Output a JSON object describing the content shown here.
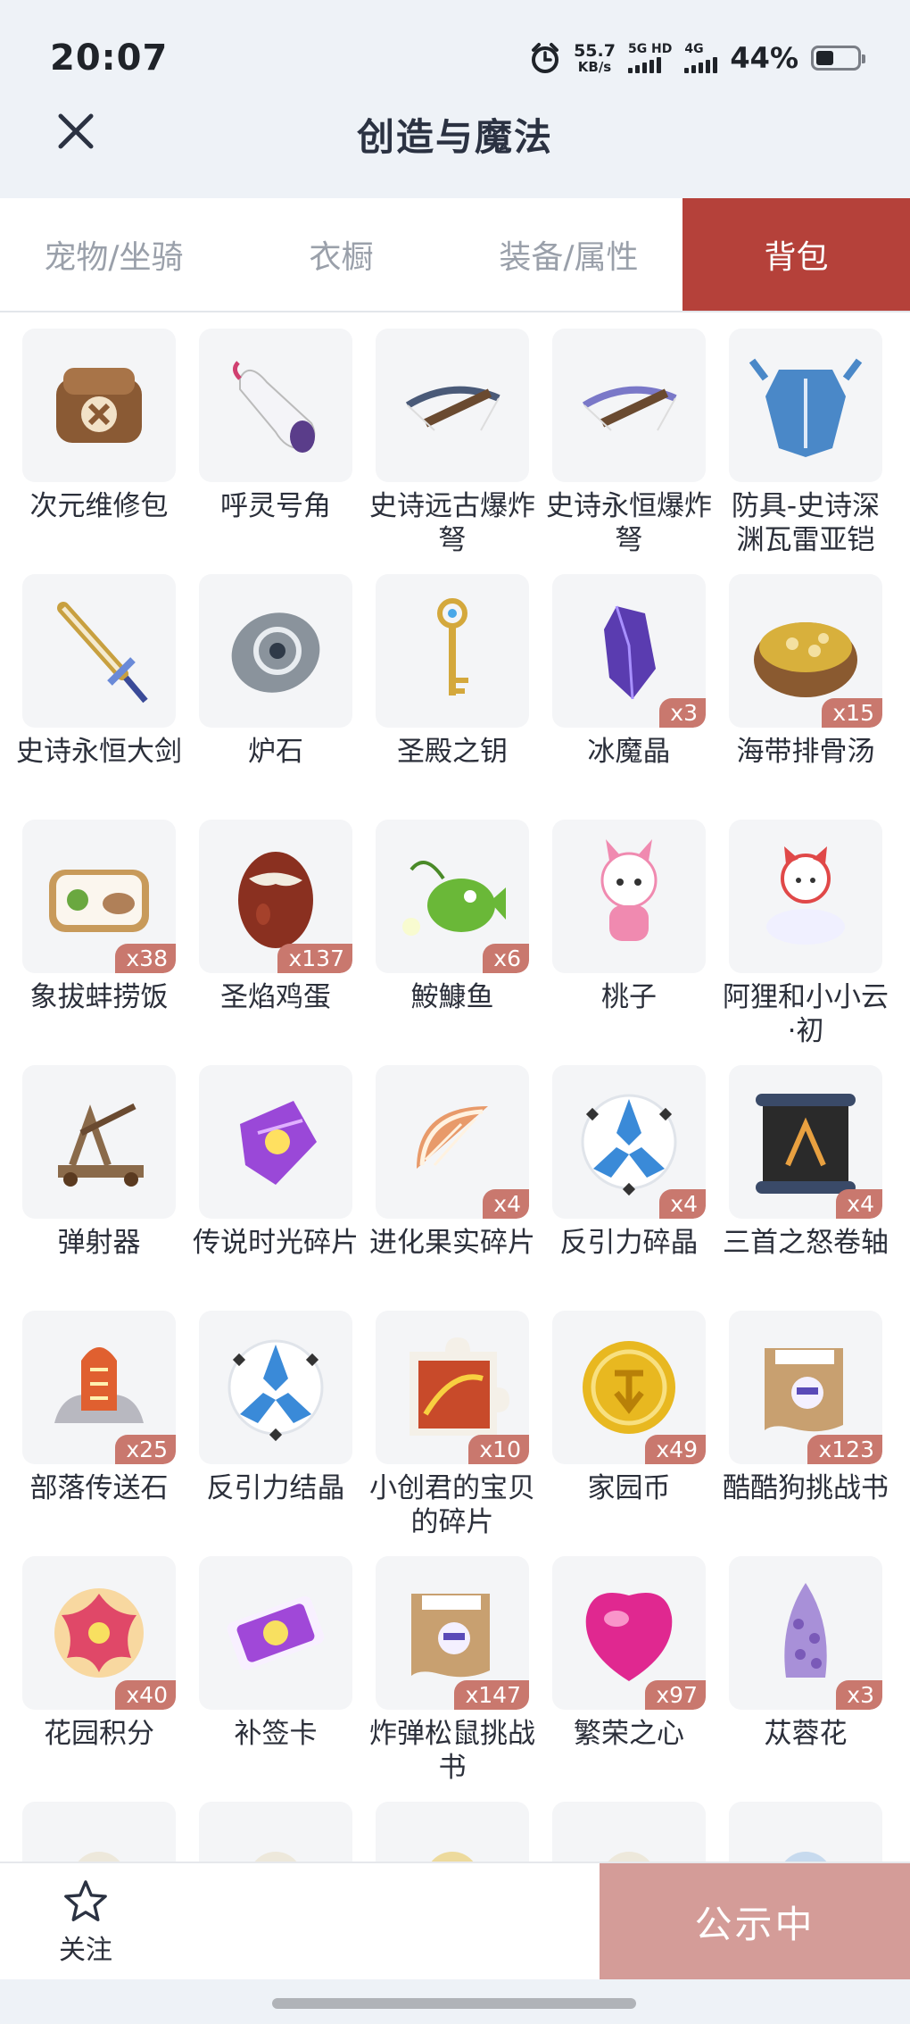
{
  "status_bar": {
    "time": "20:07",
    "net_speed": "55.7",
    "net_unit": "KB/s",
    "signal1_label": "5G HD",
    "signal2_label": "4G",
    "battery": "44%",
    "battery_level": 0.44
  },
  "header": {
    "title": "创造与魔法"
  },
  "tabs": [
    {
      "label": "宠物/坐骑",
      "active": false
    },
    {
      "label": "衣橱",
      "active": false
    },
    {
      "label": "装备/属性",
      "active": false
    },
    {
      "label": "背包",
      "active": true
    }
  ],
  "items": [
    {
      "name": "次元维修包",
      "count": "",
      "icon": "repair-bag-icon",
      "color": "#8a5a34"
    },
    {
      "name": "呼灵号角",
      "count": "",
      "icon": "horn-icon",
      "color": "#5a3d8a"
    },
    {
      "name": "史诗远古爆炸弩",
      "count": "",
      "icon": "crossbow-icon",
      "color": "#4a5a78"
    },
    {
      "name": "史诗永恒爆炸弩",
      "count": "",
      "icon": "crossbow-icon",
      "color": "#7a78c8"
    },
    {
      "name": "防具-史诗深渊瓦雷亚铠",
      "count": "",
      "icon": "armor-icon",
      "color": "#4a88c8"
    },
    {
      "name": "史诗永恒大剑",
      "count": "",
      "icon": "sword-icon",
      "color": "#c8a040"
    },
    {
      "name": "炉石",
      "count": "",
      "icon": "hearthstone-icon",
      "color": "#8a939c"
    },
    {
      "name": "圣殿之钥",
      "count": "",
      "icon": "key-icon",
      "color": "#d4a83c"
    },
    {
      "name": "冰魔晶",
      "count": "x3",
      "icon": "crystal-icon",
      "color": "#5a3cb0"
    },
    {
      "name": "海带排骨汤",
      "count": "x15",
      "icon": "soup-icon",
      "color": "#d8b03c"
    },
    {
      "name": "象拔蚌捞饭",
      "count": "x38",
      "icon": "bento-icon",
      "color": "#c89a5a"
    },
    {
      "name": "圣焰鸡蛋",
      "count": "x137",
      "icon": "egg-icon",
      "color": "#8a3020"
    },
    {
      "name": "鮟鱇鱼",
      "count": "x6",
      "icon": "fish-icon",
      "color": "#6ab838"
    },
    {
      "name": "桃子",
      "count": "",
      "icon": "pet-icon",
      "color": "#f08ab0"
    },
    {
      "name": "阿狸和小小云·初",
      "count": "",
      "icon": "pet-cloud-icon",
      "color": "#e04848"
    },
    {
      "name": "弹射器",
      "count": "",
      "icon": "catapult-icon",
      "color": "#8a6a4a"
    },
    {
      "name": "传说时光碎片",
      "count": "",
      "icon": "time-shard-icon",
      "color": "#9a48d8"
    },
    {
      "name": "进化果实碎片",
      "count": "x4",
      "icon": "fruit-shard-icon",
      "color": "#e89a6a"
    },
    {
      "name": "反引力碎晶",
      "count": "x4",
      "icon": "antigravity-icon",
      "color": "#3a8ad8"
    },
    {
      "name": "三首之怒卷轴",
      "count": "x4",
      "icon": "scroll-icon",
      "color": "#2a2a2a"
    },
    {
      "name": "部落传送石",
      "count": "x25",
      "icon": "teleport-stone-icon",
      "color": "#e06030"
    },
    {
      "name": "反引力结晶",
      "count": "",
      "icon": "antigravity-icon",
      "color": "#3a8ad8"
    },
    {
      "name": "小创君的宝贝的碎片",
      "count": "x10",
      "icon": "puzzle-icon",
      "color": "#c84a2a"
    },
    {
      "name": "家园币",
      "count": "x49",
      "icon": "coin-icon",
      "color": "#e8b820"
    },
    {
      "name": "酷酷狗挑战书",
      "count": "x123",
      "icon": "wanted-icon",
      "color": "#c8a070"
    },
    {
      "name": "花园积分",
      "count": "x40",
      "icon": "flower-badge-icon",
      "color": "#e04868"
    },
    {
      "name": "补签卡",
      "count": "",
      "icon": "ticket-icon",
      "color": "#a048d8"
    },
    {
      "name": "炸弹松鼠挑战书",
      "count": "x147",
      "icon": "wanted-icon",
      "color": "#c8a070"
    },
    {
      "name": "繁荣之心",
      "count": "x97",
      "icon": "gem-heart-icon",
      "color": "#e02890"
    },
    {
      "name": "苁蓉花",
      "count": "x3",
      "icon": "cistanche-icon",
      "color": "#a890d8"
    },
    {
      "name": "",
      "count": "",
      "icon": "partial-item-icon",
      "color": "#e8e0c8"
    },
    {
      "name": "",
      "count": "",
      "icon": "partial-item-icon",
      "color": "#e8e0c8"
    },
    {
      "name": "",
      "count": "",
      "icon": "partial-item-icon",
      "color": "#e8c860"
    },
    {
      "name": "",
      "count": "",
      "icon": "partial-item-icon",
      "color": "#e8e0c8"
    },
    {
      "name": "",
      "count": "",
      "icon": "partial-item-icon",
      "color": "#a8c8e8"
    }
  ],
  "bottom_bar": {
    "follow_label": "关注",
    "public_label": "公示中"
  },
  "colors": {
    "accent": "#b5413a",
    "badge": "#c9786e",
    "public_button": "#d49c98"
  }
}
